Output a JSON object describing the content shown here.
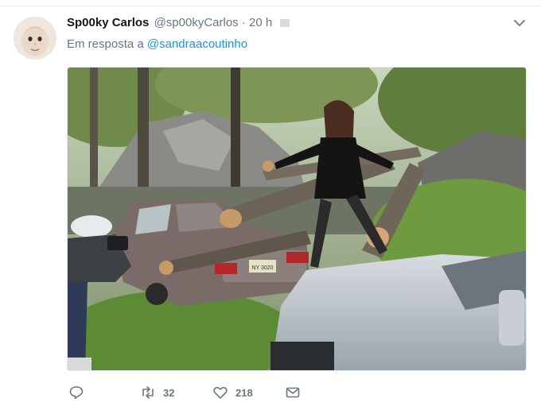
{
  "tweet": {
    "display_name": "Sp00ky Carlos",
    "handle": "@sp00kyCarlos",
    "separator": "·",
    "time": "20 h",
    "reply_prefix": "Em resposta a",
    "reply_to": "@sandraacoutinho"
  },
  "media": {
    "plate_text": "NY 3020"
  },
  "actions": {
    "reply_count": "",
    "retweet_count": "32",
    "like_count": "218"
  },
  "colors": {
    "link": "#1b95e0",
    "secondary_text": "#657786",
    "divider": "#e6ecf0"
  },
  "icons": [
    "avatar-photo",
    "verified-icon",
    "chevron-down-icon",
    "reply-icon",
    "retweet-icon",
    "like-icon",
    "direct-message-icon"
  ]
}
